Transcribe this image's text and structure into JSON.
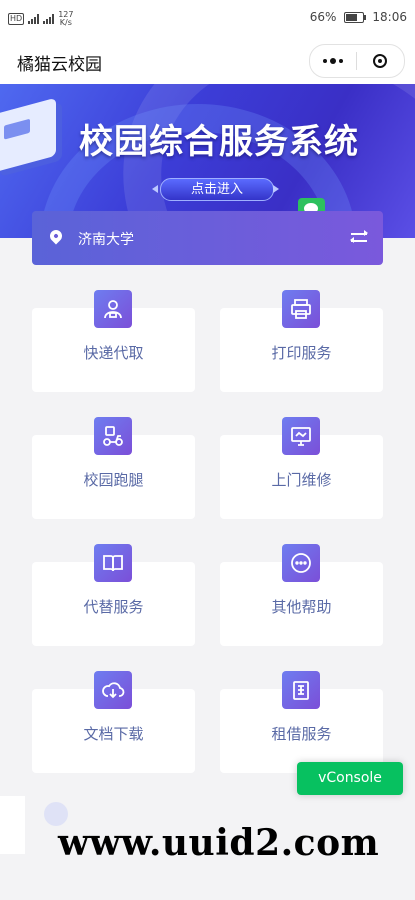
{
  "status_bar": {
    "hd": "HD",
    "net_speed_value": "127",
    "net_speed_unit": "K/s",
    "battery_percent": "66%",
    "time": "18:06"
  },
  "nav": {
    "title": "橘猫云校园"
  },
  "banner": {
    "title": "校园综合服务系统",
    "enter_button": "点击进入"
  },
  "location": {
    "name": "济南大学"
  },
  "services": [
    {
      "label": "快递代取",
      "icon": "courier-icon"
    },
    {
      "label": "打印服务",
      "icon": "printer-icon"
    },
    {
      "label": "校园跑腿",
      "icon": "scooter-icon"
    },
    {
      "label": "上门维修",
      "icon": "monitor-icon"
    },
    {
      "label": "代替服务",
      "icon": "book-icon"
    },
    {
      "label": "其他帮助",
      "icon": "more-icon"
    },
    {
      "label": "文档下载",
      "icon": "cloud-download-icon"
    },
    {
      "label": "租借服务",
      "icon": "rent-icon"
    }
  ],
  "vconsole": {
    "label": "vConsole"
  },
  "watermark": {
    "text": "www.uuid2.com"
  },
  "colors": {
    "accent_start": "#6e7df0",
    "accent_end": "#7b4fd8",
    "label_text": "#5a6aa6",
    "vconsole_green": "#07c160"
  }
}
